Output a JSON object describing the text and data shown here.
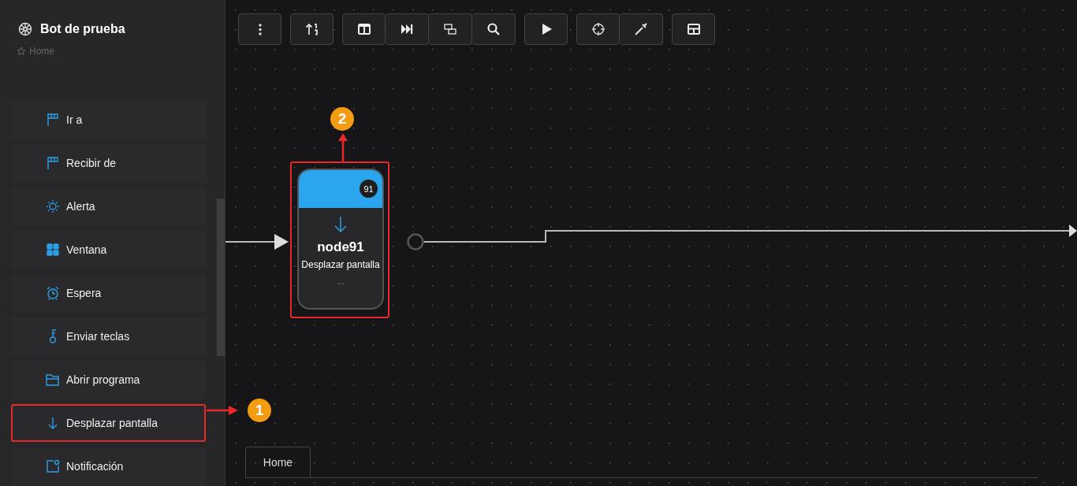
{
  "sidebar": {
    "title": "Bot de prueba",
    "breadcrumb": "Home",
    "items": [
      {
        "kind": "flag",
        "label": "Ir a",
        "outlined": false
      },
      {
        "kind": "flag",
        "label": "Recibir de",
        "outlined": false
      },
      {
        "kind": "sun",
        "label": "Alerta",
        "outlined": false
      },
      {
        "kind": "grid",
        "label": "Ventana",
        "outlined": false
      },
      {
        "kind": "alarm",
        "label": "Espera",
        "outlined": false
      },
      {
        "kind": "key",
        "label": "Enviar teclas",
        "outlined": false
      },
      {
        "kind": "folder",
        "label": "Abrir programa",
        "outlined": false
      },
      {
        "kind": "arrow",
        "label": "Desplazar pantalla",
        "outlined": true
      },
      {
        "kind": "notify",
        "label": "Notificación",
        "outlined": false
      }
    ]
  },
  "node": {
    "badge": "91",
    "name": "node91",
    "action": "Desplazar pantalla",
    "more": "...",
    "outlined": true
  },
  "callouts": [
    {
      "number": "1"
    },
    {
      "number": "2"
    }
  ],
  "tabs": [
    {
      "label": "Home",
      "selected": true
    }
  ]
}
